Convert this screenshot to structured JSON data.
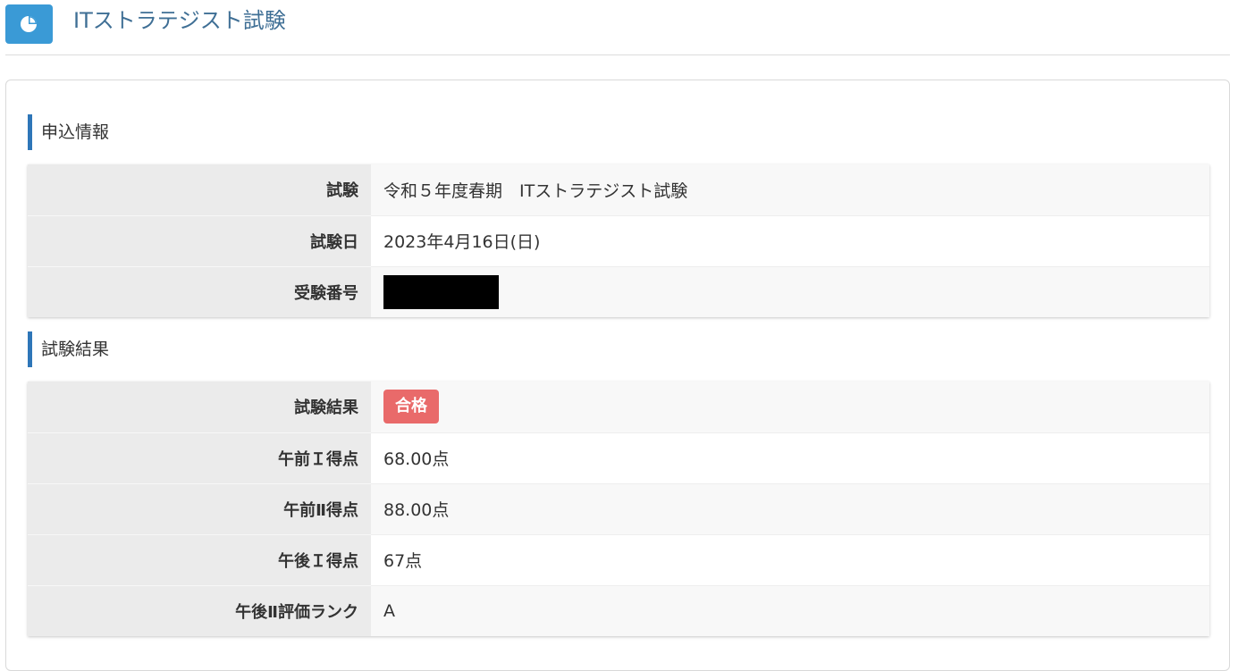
{
  "header": {
    "icon": "pie-chart-icon",
    "title": "ITストラテジスト試験"
  },
  "colors": {
    "accent": "#3a9ad6",
    "section_bar": "#2e76b8",
    "pass_badge": "#e96a6a"
  },
  "application": {
    "heading": "申込情報",
    "rows": [
      {
        "label": "試験",
        "value": "令和５年度春期　ITストラテジスト試験"
      },
      {
        "label": "試験日",
        "value": "2023年4月16日(日)"
      },
      {
        "label": "受験番号",
        "value": ""
      }
    ]
  },
  "result": {
    "heading": "試験結果",
    "status_label": "試験結果",
    "status_badge": "合格",
    "rows": [
      {
        "label": "午前Ｉ得点",
        "value": "68.00点"
      },
      {
        "label": "午前Ⅱ得点",
        "value": "88.00点"
      },
      {
        "label": "午後Ｉ得点",
        "value": "67点"
      },
      {
        "label": "午後Ⅱ評価ランク",
        "value": "A"
      }
    ]
  }
}
